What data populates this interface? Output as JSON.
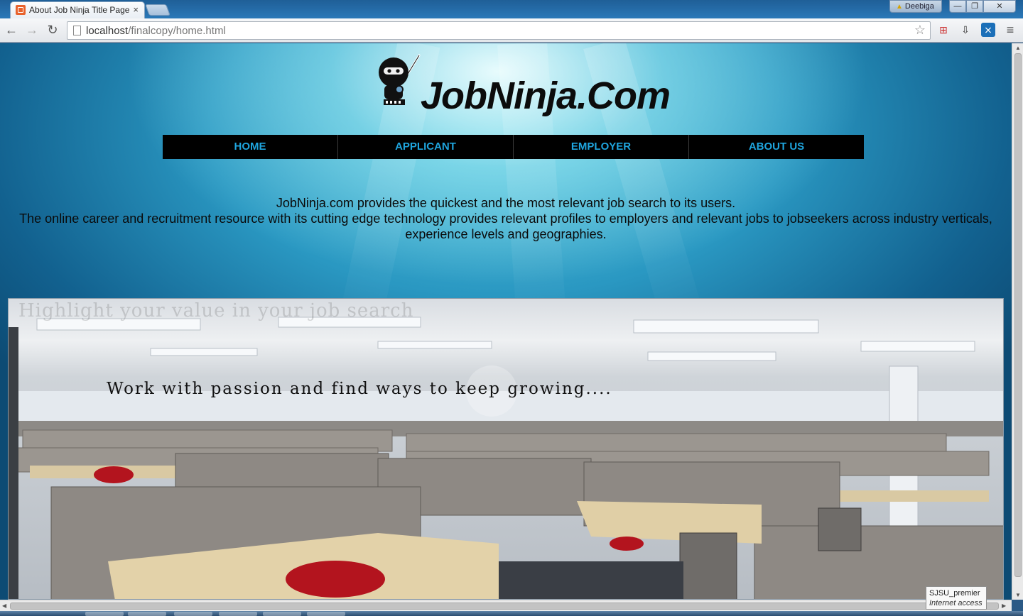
{
  "browser": {
    "tab_title": "About Job Ninja Title Page",
    "tab_close": "×",
    "user_name": "Deebiga",
    "url_host": "localhost",
    "url_path": "/finalcopy/home.html",
    "icons": [
      "back-icon",
      "forward-icon",
      "reload-icon",
      "page-icon",
      "bookmark-star-icon",
      "menu-icon"
    ]
  },
  "site": {
    "brand": "JobNinja.Com",
    "nav": [
      {
        "label": "HOME"
      },
      {
        "label": "APPLICANT"
      },
      {
        "label": "EMPLOYER"
      },
      {
        "label": "ABOUT US"
      }
    ],
    "intro_line1": "JobNinja.com provides the quickest and the most relevant job search to its users.",
    "intro_line2": "The online career and recruitment resource with its cutting edge technology provides relevant profiles to employers and relevant jobs to jobseekers across industry verticals,",
    "intro_line3": "experience levels and geographies.",
    "hero_watermark": "Highlight your value in your job search",
    "hero_tagline": "Work with passion and find ways to keep growing....",
    "nav_color": "#1fa5de",
    "background_color": "#2a98c2"
  },
  "status": {
    "network_name": "SJSU_premier",
    "network_state": "Internet access"
  }
}
